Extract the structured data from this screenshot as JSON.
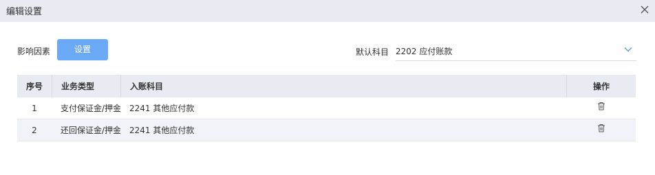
{
  "dialog": {
    "title": "编辑设置"
  },
  "factor": {
    "label": "影响因素",
    "button_label": "设置"
  },
  "default_account": {
    "label": "默认科目",
    "value": "2202 应付账款"
  },
  "table": {
    "headers": {
      "no": "序号",
      "type": "业务类型",
      "account": "入账科目",
      "operation": "操作"
    },
    "rows": [
      {
        "no": "1",
        "type": "支付保证金/押金",
        "account": "2241 其他应付款"
      },
      {
        "no": "2",
        "type": "还回保证金/押金",
        "account": "2241 其他应付款"
      }
    ]
  },
  "icons": {
    "close": "close-icon",
    "dropdown": "chevron-down-icon",
    "delete": "trash-icon"
  },
  "colors": {
    "accent": "#6aa9f5",
    "header_bg": "#e8ebf2",
    "alt_row_bg": "#f2f3f8"
  }
}
